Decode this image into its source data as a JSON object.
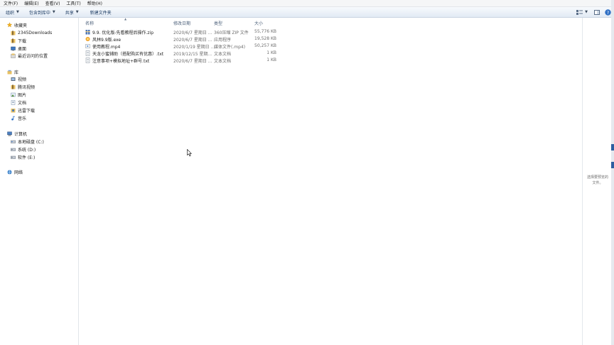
{
  "menu": [
    {
      "label": "文件(F)"
    },
    {
      "label": "编辑(E)"
    },
    {
      "label": "查看(V)"
    },
    {
      "label": "工具(T)"
    },
    {
      "label": "帮助(H)"
    }
  ],
  "toolbar": {
    "organize": "组织",
    "include_library": "包含到库中",
    "share": "共享",
    "new_folder": "新建文件夹",
    "icons": [
      "view-icon",
      "chevron-down-icon",
      "preview-pane-icon",
      "help-icon"
    ]
  },
  "sidebar": {
    "favorites": {
      "header": "收藏夹",
      "items": [
        {
          "label": "2345Downloads",
          "icon": "folder-icon"
        },
        {
          "label": "下载",
          "icon": "folder-icon"
        },
        {
          "label": "桌面",
          "icon": "desktop-icon"
        },
        {
          "label": "最近访问的位置",
          "icon": "recent-icon"
        }
      ]
    },
    "libraries": {
      "header": "库",
      "items": [
        {
          "label": "视频",
          "icon": "video-icon"
        },
        {
          "label": "腾讯视频",
          "icon": "folder-icon"
        },
        {
          "label": "图片",
          "icon": "picture-icon"
        },
        {
          "label": "文档",
          "icon": "document-icon"
        },
        {
          "label": "迅雷下载",
          "icon": "download-icon"
        },
        {
          "label": "音乐",
          "icon": "music-icon"
        }
      ]
    },
    "computer": {
      "header": "计算机",
      "items": [
        {
          "label": "本地磁盘 (C:)",
          "icon": "drive-icon"
        },
        {
          "label": "系统 (D:)",
          "icon": "drive-icon"
        },
        {
          "label": "软件 (E:)",
          "icon": "drive-icon"
        }
      ]
    },
    "network": {
      "header": "网络"
    }
  },
  "columns": {
    "name": "名称",
    "date": "修改日期",
    "type": "类型",
    "size": "大小"
  },
  "files": [
    {
      "name": "9.9. 优化版-先看教程后操作.zip",
      "date": "2020/6/7 星期日 ...",
      "type": "360压缩 ZIP 文件",
      "size": "55,776 KB",
      "icon": "zip-icon"
    },
    {
      "name": "风林9.9版.exe",
      "date": "2020/6/7 星期日 ...",
      "type": "应用程序",
      "size": "19,528 KB",
      "icon": "exe-icon"
    },
    {
      "name": "使用教程.mp4",
      "date": "2020/1/19 星期日 ...",
      "type": "媒体文件(.mp4)",
      "size": "50,257 KB",
      "icon": "video-file-icon"
    },
    {
      "name": "天龙小蜜辅助（搭配购买有优惠）.txt",
      "date": "2019/12/15 星期...",
      "type": "文本文档",
      "size": "1 KB",
      "icon": "text-file-icon"
    },
    {
      "name": "注意事项+模拟地址+群号.txt",
      "date": "2020/6/7 星期日 ...",
      "type": "文本文档",
      "size": "1 KB",
      "icon": "text-file-icon"
    }
  ],
  "preview": {
    "line1": "选择要预览的",
    "line2": "文件。"
  },
  "colors": {
    "toolbar_text": "#1e3d64",
    "star": "#f2b01e",
    "folder": "#e8c062"
  }
}
